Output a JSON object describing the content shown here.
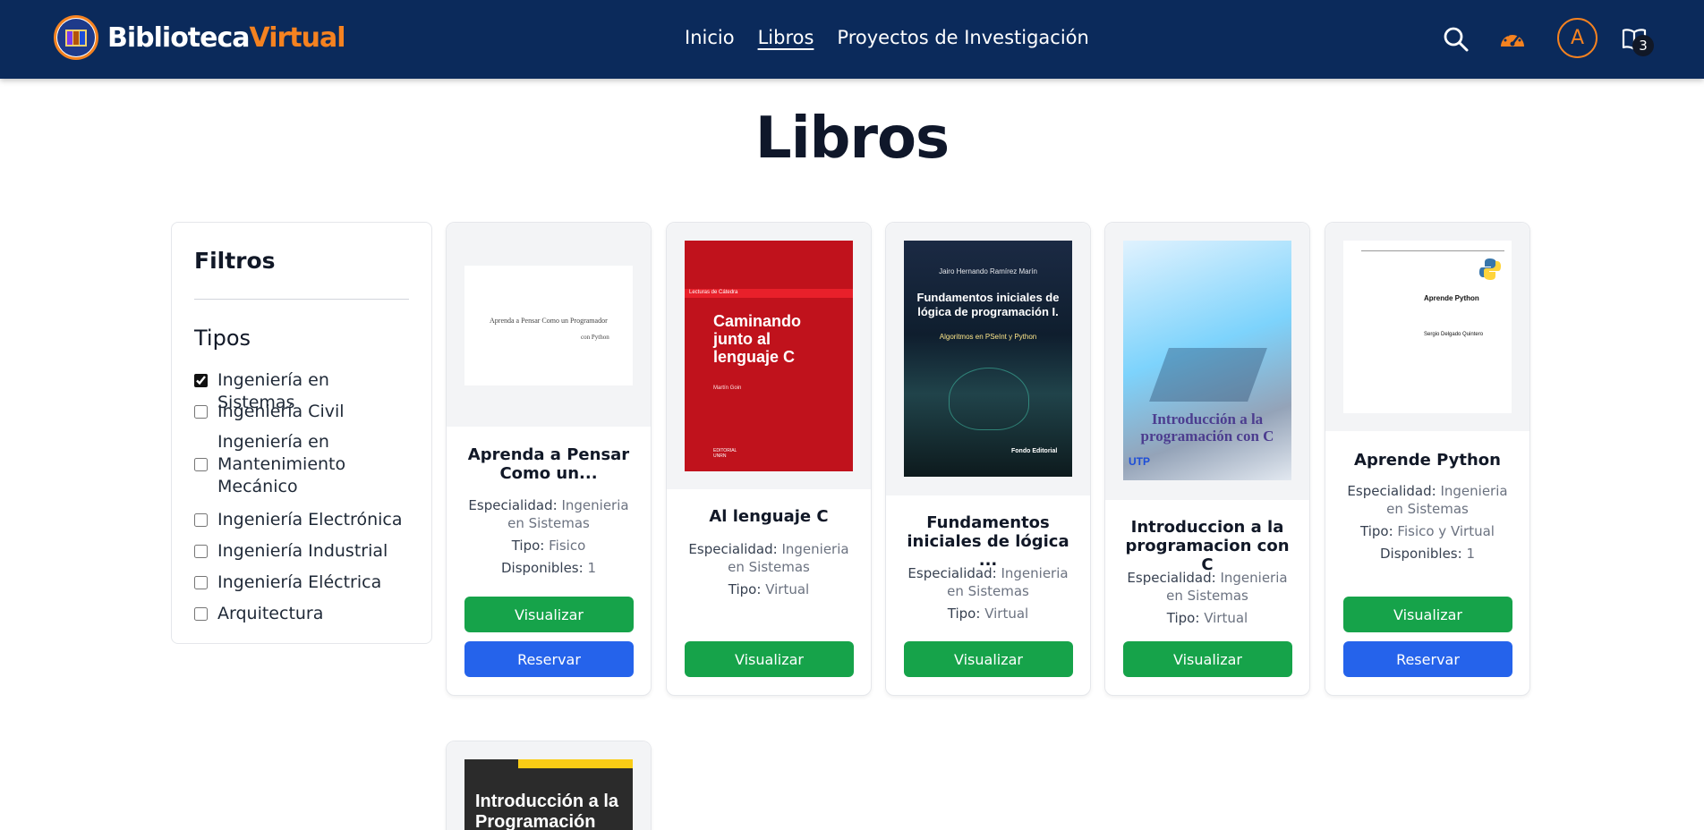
{
  "brand": {
    "part1": "Biblioteca",
    "part2": "Virtual"
  },
  "nav": {
    "links": [
      "Inicio",
      "Libros",
      "Proyectos de Investigación"
    ],
    "avatar_letter": "A",
    "book_count": "3"
  },
  "page": {
    "title": "Libros"
  },
  "filters": {
    "title": "Filtros",
    "subtitle": "Tipos",
    "items": [
      {
        "label": "Ingeniería en Sistemas",
        "checked": true
      },
      {
        "label": "Ingeniería Civil",
        "checked": false
      },
      {
        "label": "Ingeniería en Mantenimiento Mecánico",
        "checked": false
      },
      {
        "label": "Ingeniería Electrónica",
        "checked": false
      },
      {
        "label": "Ingeniería Industrial",
        "checked": false
      },
      {
        "label": "Ingeniería Eléctrica",
        "checked": false
      },
      {
        "label": "Arquitectura",
        "checked": false
      }
    ]
  },
  "labels": {
    "especialidad": "Especialidad:",
    "tipo": "Tipo:",
    "disponibles": "Disponibles:",
    "visualizar": "Visualizar",
    "reservar": "Reservar"
  },
  "books": [
    {
      "title": "Aprenda a Pensar Como un...",
      "especialidad": "Ingenieria en Sistemas",
      "tipo": "Fisico",
      "disponibles": "1",
      "cover": {
        "line1": "Aprenda a Pensar Como un Programador",
        "line2": "con Python"
      }
    },
    {
      "title": "Al lenguaje C",
      "especialidad": "Ingenieria en Sistemas",
      "tipo": "Virtual",
      "cover": {
        "series": "Lecturas de Cátedra",
        "title": "Caminando junto al lenguaje C",
        "author": "Martín Goin",
        "publisher": "EDITORIAL UNRN"
      }
    },
    {
      "title": "Fundamentos iniciales de lógica ...",
      "especialidad": "Ingenieria en Sistemas",
      "tipo": "Virtual",
      "cover": {
        "author": "Jairo Hernando Ramírez Marín",
        "title": "Fundamentos iniciales de lógica de programación I.",
        "subtitle": "Algoritmos en PSeInt y Python",
        "publisher": "Fondo Editorial"
      }
    },
    {
      "title": "Introduccion a la programacion con C",
      "especialidad": "Ingenieria en Sistemas",
      "tipo": "Virtual",
      "cover": {
        "title": "Introducción a la programación con C",
        "logo": "UTP"
      }
    },
    {
      "title": "Aprende Python",
      "especialidad": "Ingenieria en Sistemas",
      "tipo": "Fisico y Virtual",
      "disponibles": "1",
      "cover": {
        "title": "Aprende Python",
        "author": "Sergio Delgado Quintero"
      }
    },
    {
      "cover": {
        "title": "Introducción a la Programación"
      }
    }
  ]
}
